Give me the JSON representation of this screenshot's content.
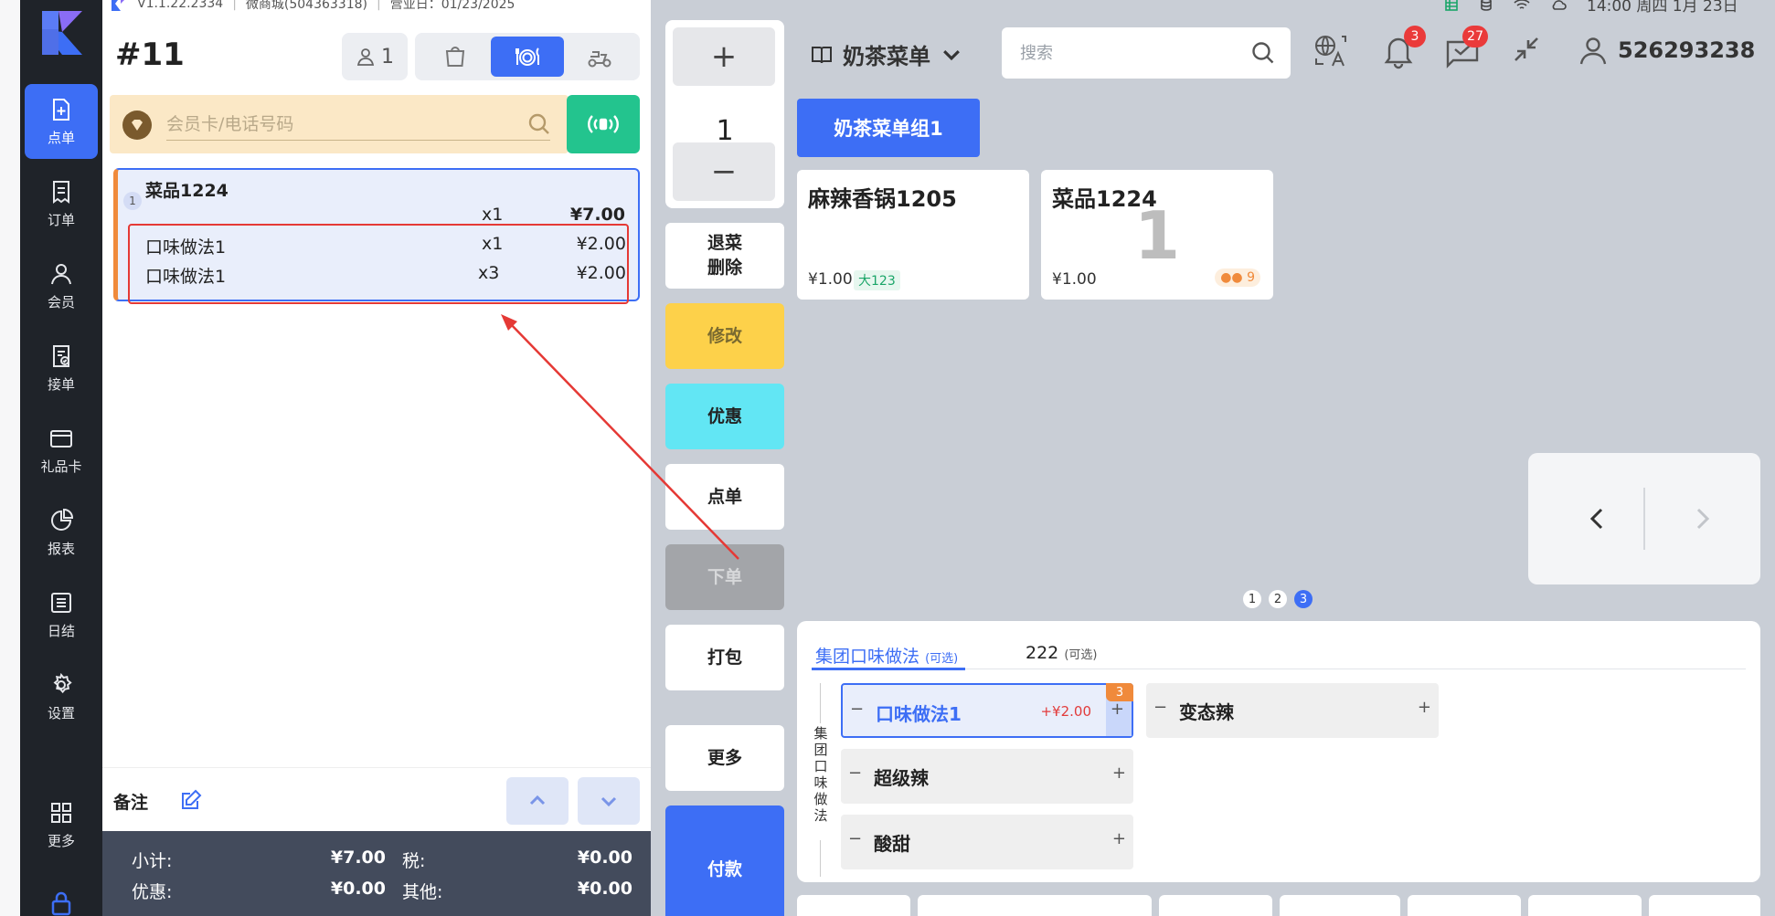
{
  "top_info": {
    "version": "V1.1.22.2334",
    "store": "微商城(504363318)",
    "business_date": "营业日：01/23/2025"
  },
  "top_status": {
    "clock": "14:00 周四 1月 23日"
  },
  "sidebar": {
    "items": [
      {
        "label": "点单",
        "icon": "add-file-icon"
      },
      {
        "label": "订单",
        "icon": "receipt-icon"
      },
      {
        "label": "会员",
        "icon": "person-icon"
      },
      {
        "label": "接单",
        "icon": "order-check-icon"
      },
      {
        "label": "礼品卡",
        "icon": "card-icon"
      },
      {
        "label": "报表",
        "icon": "pie-chart-icon"
      },
      {
        "label": "日结",
        "icon": "list-icon"
      },
      {
        "label": "设置",
        "icon": "gear-icon"
      },
      {
        "label": "更多",
        "icon": "grid-icon"
      }
    ]
  },
  "order": {
    "number": "#11",
    "guests": "1",
    "member_placeholder": "会员卡/电话号码",
    "items": [
      {
        "seq": "1",
        "name": "菜品1224",
        "qty": "x1",
        "price": "¥7.00",
        "modifiers": [
          {
            "name": "口味做法1",
            "qty": "x1",
            "price": "¥2.00"
          },
          {
            "name": "口味做法1",
            "qty": "x3",
            "price": "¥2.00"
          }
        ]
      }
    ],
    "remark_label": "备注",
    "totals": {
      "subtotal_label": "小计:",
      "subtotal": "¥7.00",
      "tax_label": "税:",
      "tax": "¥0.00",
      "discount_label": "优惠:",
      "discount": "¥0.00",
      "other_label": "其他:",
      "other": "¥0.00"
    }
  },
  "actions": {
    "plus": "+",
    "qty": "1",
    "minus": "−",
    "return_line1": "退菜",
    "return_line2": "删除",
    "modify": "修改",
    "promo": "优惠",
    "order": "点单",
    "place": "下单",
    "pack": "打包",
    "more": "更多",
    "pay": "付款"
  },
  "menu": {
    "title": "奶茶菜单",
    "search_placeholder": "搜索",
    "notifications": "3",
    "messages": "27",
    "user": "526293238",
    "group_tab": "奶茶菜单组1",
    "dishes": [
      {
        "name": "麻辣香锅1205",
        "price": "¥1.00",
        "tag": "大123"
      },
      {
        "name": "菜品1224",
        "price": "¥1.00",
        "big_qty": "1",
        "stock": "9"
      }
    ],
    "pages": [
      "1",
      "2",
      "3"
    ],
    "active_page": 3
  },
  "modifiers": {
    "tabs": [
      {
        "label": "集团口味做法",
        "note": "(可选)"
      },
      {
        "label": "222",
        "note": "(可选)"
      }
    ],
    "group_vertical_label": [
      "集",
      "团",
      "口",
      "味",
      "做",
      "法"
    ],
    "options": [
      {
        "name": "口味做法1",
        "extra": "+¥2.00",
        "count": "3",
        "selected": true
      },
      {
        "name": "变态辣"
      },
      {
        "name": "超级辣"
      },
      {
        "name": "酸甜"
      }
    ],
    "minus": "−",
    "plus": "+"
  },
  "colors": {
    "accent": "#3d6ef5",
    "member_bg": "#fbe8c6",
    "nfc": "#23c48e",
    "modify": "#fdd14a",
    "promo": "#62e6f4",
    "annotation": "#e53935"
  }
}
